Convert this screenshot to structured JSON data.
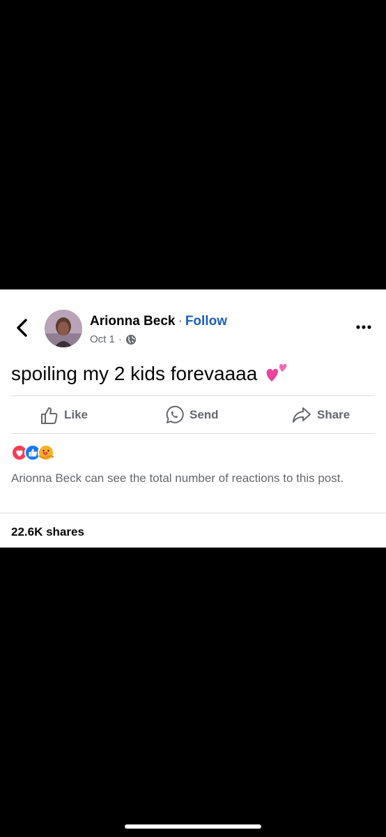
{
  "post": {
    "author": "Arionna Beck",
    "separator": "·",
    "follow_label": "Follow",
    "date": "Oct 1",
    "date_separator": "·",
    "privacy_icon": "globe-icon",
    "text": "spoiling my 2 kids forevaaaa",
    "emoji": "two-hearts-emoji"
  },
  "actions": [
    {
      "label": "Like",
      "icon": "thumbs-up-icon"
    },
    {
      "label": "Send",
      "icon": "whatsapp-icon"
    },
    {
      "label": "Share",
      "icon": "share-arrow-icon"
    }
  ],
  "reactions": {
    "icons": [
      "love-reaction",
      "like-reaction",
      "care-reaction"
    ],
    "note": "Arionna Beck can see the total number of reactions to this post."
  },
  "shares_label": "22.6K shares",
  "colors": {
    "link": "#1b5fb5",
    "muted": "#65676b",
    "love": "#f33e58",
    "like": "#1877f2",
    "care": "#f7b125"
  }
}
